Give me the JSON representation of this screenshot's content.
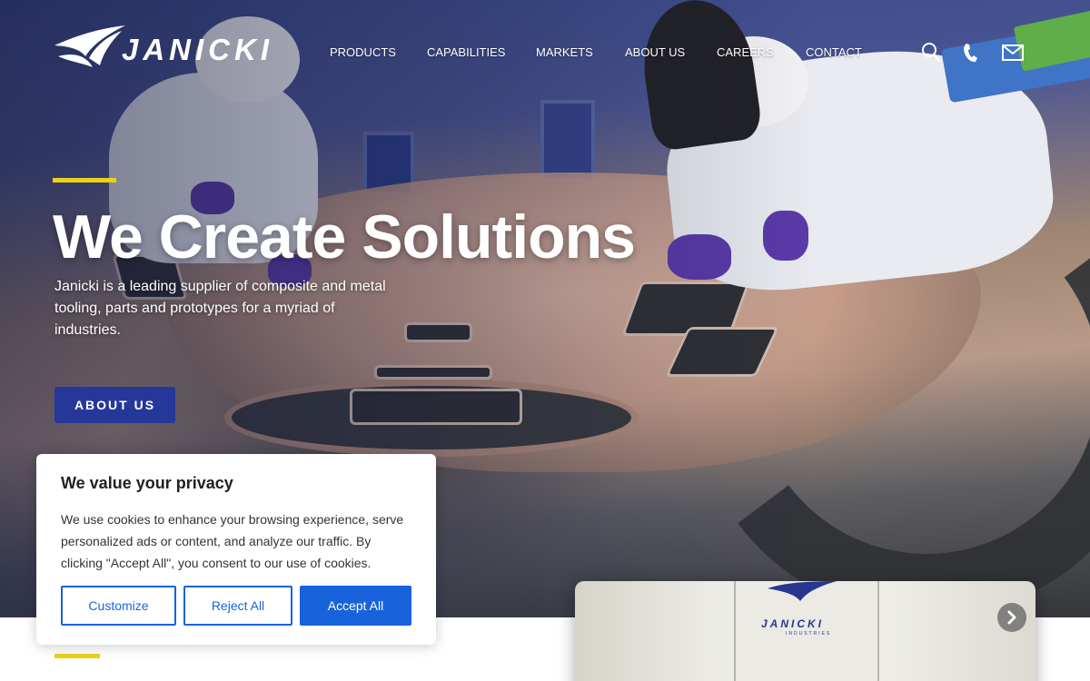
{
  "brand": {
    "name": "JANICKI",
    "machine_label": "JANICKI",
    "machine_sublabel": "INDUSTRIES"
  },
  "nav": {
    "items": [
      {
        "label": "PRODUCTS"
      },
      {
        "label": "CAPABILITIES"
      },
      {
        "label": "MARKETS"
      },
      {
        "label": "ABOUT US"
      },
      {
        "label": "CAREERS"
      },
      {
        "label": "CONTACT"
      }
    ],
    "icons": [
      "search-icon",
      "phone-icon",
      "mail-icon"
    ]
  },
  "hero": {
    "title": "We Create Solutions",
    "subtitle": "Janicki is a leading supplier of composite and metal tooling, parts and prototypes for a myriad of industries.",
    "cta_label": "ABOUT US"
  },
  "cookie": {
    "title": "We value your privacy",
    "text": "We use cookies to enhance your browsing experience, serve personalized ads or content, and analyze our traffic. By clicking \"Accept All\", you consent to our use of cookies.",
    "customize_label": "Customize",
    "reject_label": "Reject All",
    "accept_label": "Accept All"
  },
  "colors": {
    "accent_yellow": "#e8d21a",
    "brand_blue": "#26379a",
    "cookie_blue": "#1863dc",
    "glove_purple": "#5a3aa8"
  }
}
